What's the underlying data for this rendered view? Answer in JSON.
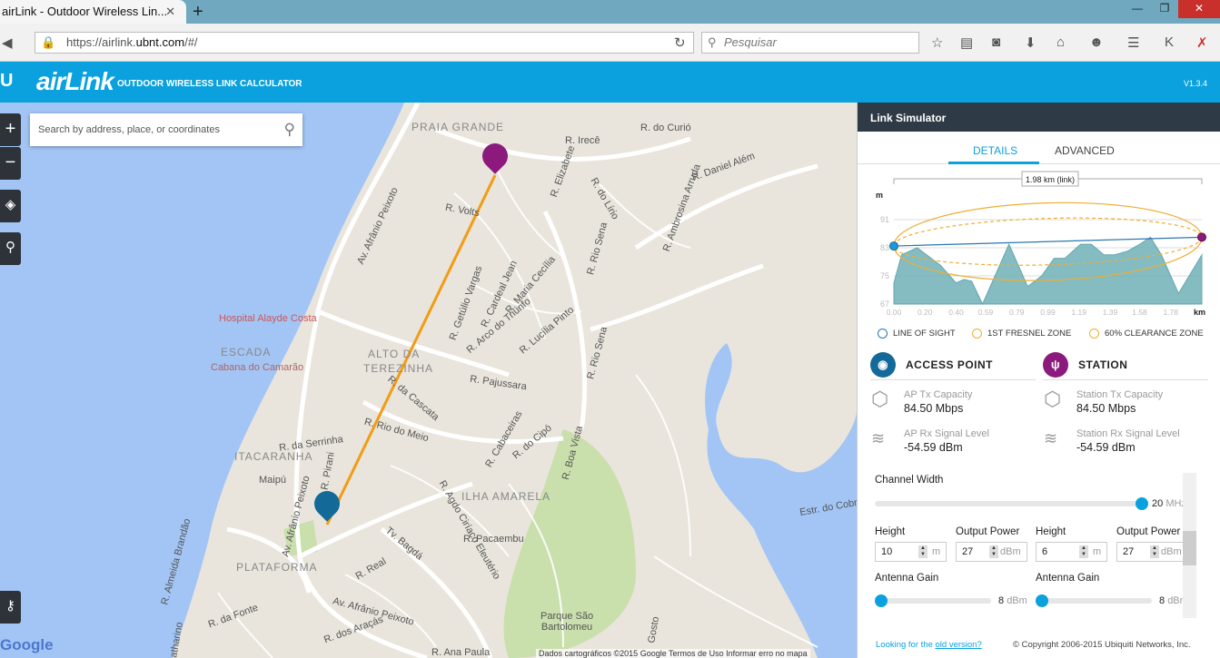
{
  "browser": {
    "tab_title": "airLink - Outdoor Wireless Lin...",
    "url_prefix": "https://airlink.",
    "url_domain": "ubnt.com",
    "url_suffix": "/#/",
    "search_placeholder": "Pesquisar"
  },
  "app": {
    "logo": "airLink",
    "subtitle": "OUTDOOR WIRELESS LINK CALCULATOR",
    "version": "V1.3.4"
  },
  "map": {
    "search_placeholder": "Search by address, place, or coordinates",
    "streets": [
      "PRAIA GRANDE",
      "R. do Curió",
      "R. Irecê",
      "R. Daniel Além",
      "R. Elizabete",
      "R. do Lírio",
      "R. Volts",
      "Av. Afrânio Peixoto",
      "R. Getúlio Vargas",
      "R. Cardeal Jean",
      "R. Maria Cecília",
      "R. Rio Sena",
      "R. Ambrosina Arruda",
      "R. Arco do Triunfo",
      "R. Lucília Pinto",
      "Hospital Alayde Costa",
      "ESCADA",
      "Cabana do Camarão",
      "ALTO DA TEREZINHA",
      "R. Pajussara",
      "R. Rio Sena",
      "R. da Cascata",
      "R. Rio do Meio",
      "R. da Serrinha",
      "R. Cabaceiras",
      "R. do Cipó",
      "R. Boa Vista",
      "ITACARANHA",
      "R. Pirani",
      "Maipú",
      "ILHA AMARELA",
      "R. Agdo Ciríaco Eleutério",
      "R. Pacaembu",
      "Tv. Bagdá",
      "R. Real",
      "PLATAFORMA",
      "R. Almeida Brandão",
      "Av. Afrânio Peixoto",
      "R. da Fonte",
      "R. dos Araçás",
      "Parque São Bartolomeu",
      "R. Ana Paula",
      "Estr. do Cobre",
      "Gosto",
      "Catharino"
    ],
    "attribution": "Dados cartográficos ©2015 Google   Termos de Uso   Informar erro no mapa",
    "google": "Google"
  },
  "panel": {
    "title": "Link Simulator",
    "tabs": [
      "DETAILS",
      "ADVANCED"
    ],
    "active_tab": "DETAILS",
    "legend": [
      "LINE OF SIGHT",
      "1ST FRESNEL ZONE",
      "60% CLEARANCE ZONE"
    ],
    "access_point": {
      "title": "ACCESS POINT",
      "tx_label": "AP Tx Capacity",
      "tx_value": "84.50 Mbps",
      "rx_label": "AP Rx Signal Level",
      "rx_value": "-54.59 dBm"
    },
    "station": {
      "title": "STATION",
      "tx_label": "Station Tx Capacity",
      "tx_value": "84.50 Mbps",
      "rx_label": "Station Rx Signal Level",
      "rx_value": "-54.59 dBm"
    },
    "channel_width": {
      "label": "Channel Width",
      "value": "20",
      "unit": "MHz",
      "fraction": 1.0
    },
    "ap_settings": {
      "height_label": "Height",
      "height": "10",
      "height_unit": "m",
      "power_label": "Output Power",
      "power": "27",
      "power_unit": "dBm",
      "gain_label": "Antenna Gain",
      "gain": "8",
      "gain_unit": "dBm",
      "gain_fraction": 0.0
    },
    "st_settings": {
      "height_label": "Height",
      "height": "6",
      "height_unit": "m",
      "power_label": "Output Power",
      "power": "27",
      "power_unit": "dBm",
      "gain_label": "Antenna Gain",
      "gain": "8",
      "gain_unit": "dBm",
      "gain_fraction": 0.0
    },
    "footer_text": "Looking for the ",
    "footer_link": "old version?",
    "copyright": "© Copyright 2006-2015 Ubiquiti Networks, Inc."
  },
  "colors": {
    "accent": "#0aa1de",
    "terrain": "#6fb1b8",
    "fresnel": "#f0ad30",
    "los": "#2a78b0",
    "station": "#8b1a7c"
  },
  "chart_data": {
    "type": "area",
    "title": "1.98 km (link)",
    "xlabel": "km",
    "ylabel": "m",
    "xticks": [
      "0.00",
      "0.20",
      "0.40",
      "0.59",
      "0.79",
      "0.99",
      "1.19",
      "1.39",
      "1.58",
      "1.78"
    ],
    "yticks": [
      "91",
      "83",
      "75",
      "67"
    ],
    "xlim": [
      0,
      1.98
    ],
    "ylim": [
      67,
      99
    ],
    "terrain": {
      "x": [
        0,
        0.05,
        0.15,
        0.3,
        0.4,
        0.45,
        0.5,
        0.57,
        0.65,
        0.74,
        0.86,
        0.95,
        1.03,
        1.1,
        1.2,
        1.27,
        1.35,
        1.42,
        1.5,
        1.58,
        1.65,
        1.72,
        1.83,
        1.98
      ],
      "y": [
        73,
        81,
        83,
        78,
        73,
        74,
        73.5,
        67,
        75,
        84,
        72,
        75,
        80,
        80,
        84,
        84,
        81,
        81,
        82,
        84,
        86,
        81,
        70,
        81
      ]
    },
    "line_of_sight": {
      "start": 83.5,
      "end": 86
    },
    "fresnel_radius_m": 11,
    "clearance_radius_m": 6.6
  }
}
